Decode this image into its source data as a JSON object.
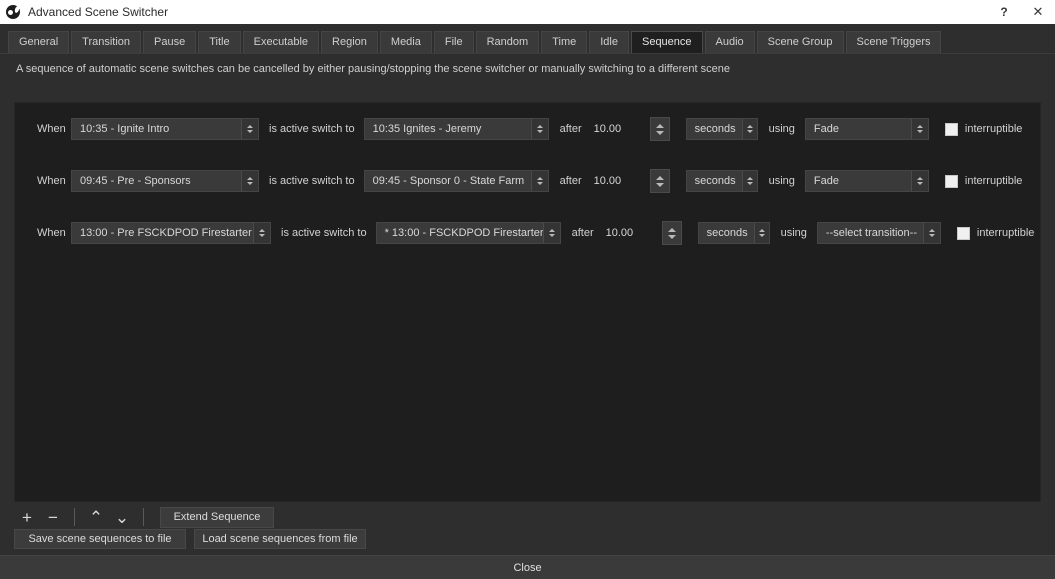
{
  "titlebar": {
    "title": "Advanced Scene Switcher",
    "help_label": "?",
    "close_label": "✕"
  },
  "tabs": [
    {
      "label": "General",
      "active": false
    },
    {
      "label": "Transition",
      "active": false
    },
    {
      "label": "Pause",
      "active": false
    },
    {
      "label": "Title",
      "active": false
    },
    {
      "label": "Executable",
      "active": false
    },
    {
      "label": "Region",
      "active": false
    },
    {
      "label": "Media",
      "active": false
    },
    {
      "label": "File",
      "active": false
    },
    {
      "label": "Random",
      "active": false
    },
    {
      "label": "Time",
      "active": false
    },
    {
      "label": "Idle",
      "active": false
    },
    {
      "label": "Sequence",
      "active": true
    },
    {
      "label": "Audio",
      "active": false
    },
    {
      "label": "Scene Group",
      "active": false
    },
    {
      "label": "Scene Triggers",
      "active": false
    }
  ],
  "description": "A sequence of automatic scene switches can be cancelled by either pausing/stopping the scene switcher or manually switching to a different scene",
  "row_labels": {
    "when": "When",
    "is_active_switch_to": "is active switch to",
    "after": "after",
    "using": "using",
    "interruptible": "interruptible"
  },
  "sequences": [
    {
      "from_scene": "10:35 - Ignite Intro",
      "to_scene": "10:35 Ignites - Jeremy",
      "delay": "10.00",
      "units": "seconds",
      "transition": "Fade",
      "interruptible": false
    },
    {
      "from_scene": "09:45 - Pre - Sponsors",
      "to_scene": "09:45 - Sponsor 0 - State Farm",
      "delay": "10.00",
      "units": "seconds",
      "transition": "Fade",
      "interruptible": false
    },
    {
      "from_scene": "13:00 - Pre FSCKDPOD Firestarter",
      "to_scene": "* 13:00 - FSCKDPOD Firestarter",
      "delay": "10.00",
      "units": "seconds",
      "transition": "--select transition--",
      "interruptible": false
    }
  ],
  "toolbar": {
    "add_label": "+",
    "remove_label": "−",
    "move_up_label": "⌃",
    "move_down_label": "⌄",
    "extend_label": "Extend Sequence",
    "save_to_file_label": "Save scene sequences to file",
    "load_from_file_label": "Load scene sequences from file"
  },
  "footer": {
    "close_label": "Close"
  },
  "colors": {
    "window_bg": "#2e2e2e",
    "panel_bg": "#1e1e1e",
    "titlebar_bg": "#ffffff",
    "control_bg": "#3a3a3a",
    "text": "#d4d4d4"
  }
}
